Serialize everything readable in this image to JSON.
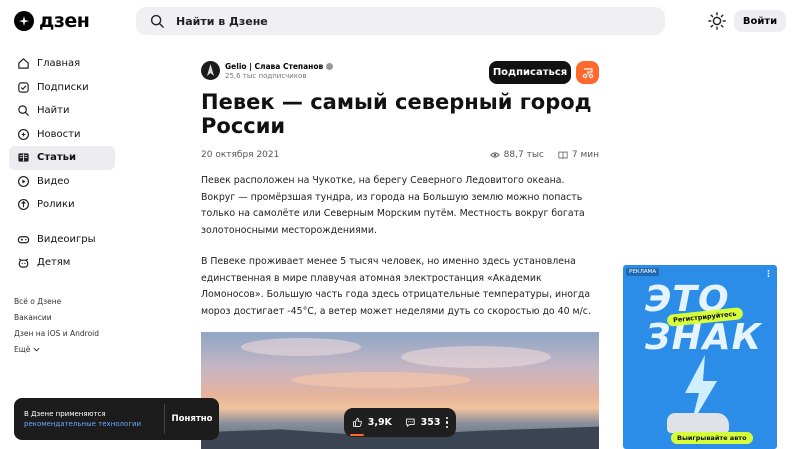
{
  "header": {
    "logo_text": "дзен",
    "search_placeholder": "Найти в Дзене",
    "login_label": "Войти"
  },
  "sidebar": {
    "items": [
      {
        "label": "Главная",
        "icon": "home-icon"
      },
      {
        "label": "Подписки",
        "icon": "subscriptions-icon"
      },
      {
        "label": "Найти",
        "icon": "search-icon"
      },
      {
        "label": "Новости",
        "icon": "news-icon"
      },
      {
        "label": "Статьи",
        "icon": "articles-icon",
        "active": true
      },
      {
        "label": "Видео",
        "icon": "video-icon"
      },
      {
        "label": "Ролики",
        "icon": "shorts-icon"
      }
    ],
    "items2": [
      {
        "label": "Видеоигры",
        "icon": "gamepad-icon"
      },
      {
        "label": "Детям",
        "icon": "kids-icon"
      }
    ],
    "footer_links": [
      "Всё о Дзене",
      "Вакансии",
      "Дзен на iOS и Android",
      "Ещё"
    ]
  },
  "article": {
    "author_name": "Gelio | Слава Степанов",
    "author_subs": "25,6 тыс подписчиков",
    "subscribe_label": "Подписаться",
    "title": "Певек — самый северный город России",
    "date": "20 октября 2021",
    "views": "88,7 тыс",
    "read_time": "7 мин",
    "paragraphs": [
      "Певек расположен на Чукотке, на берегу Северного Ледовитого океана. Вокруг — промёрзшая тундра, из города на Большую землю можно попасть только на самолёте или Северным Морским путём. Местность вокруг богата золотоносными месторождениями.",
      "В Певеке проживает менее 5 тысяч человек, но именно здесь установлена единственная в мире плавучая атомная электростанция «Академик Ломоносов». Большую часть года здесь отрицательные температуры, иногда мороз достигает -45°C, а ветер может неделями дуть со скоростью до 40 м/с."
    ]
  },
  "reactions": {
    "likes": "3,9K",
    "comments": "353"
  },
  "cookie": {
    "text": "В Дзене применяются",
    "link": "рекомендательные технологии",
    "button": "Понятно"
  },
  "ad": {
    "label": "РЕКЛАМА",
    "headline1": "ЭТО",
    "headline2": "ЗНАК",
    "pill": "Регистрируйтесь",
    "cta": "Выигрывайте авто"
  },
  "colors": {
    "accent": "#ff6a2c",
    "ad_bg": "#2b8de8",
    "ad_lime": "#d6ff3a"
  }
}
